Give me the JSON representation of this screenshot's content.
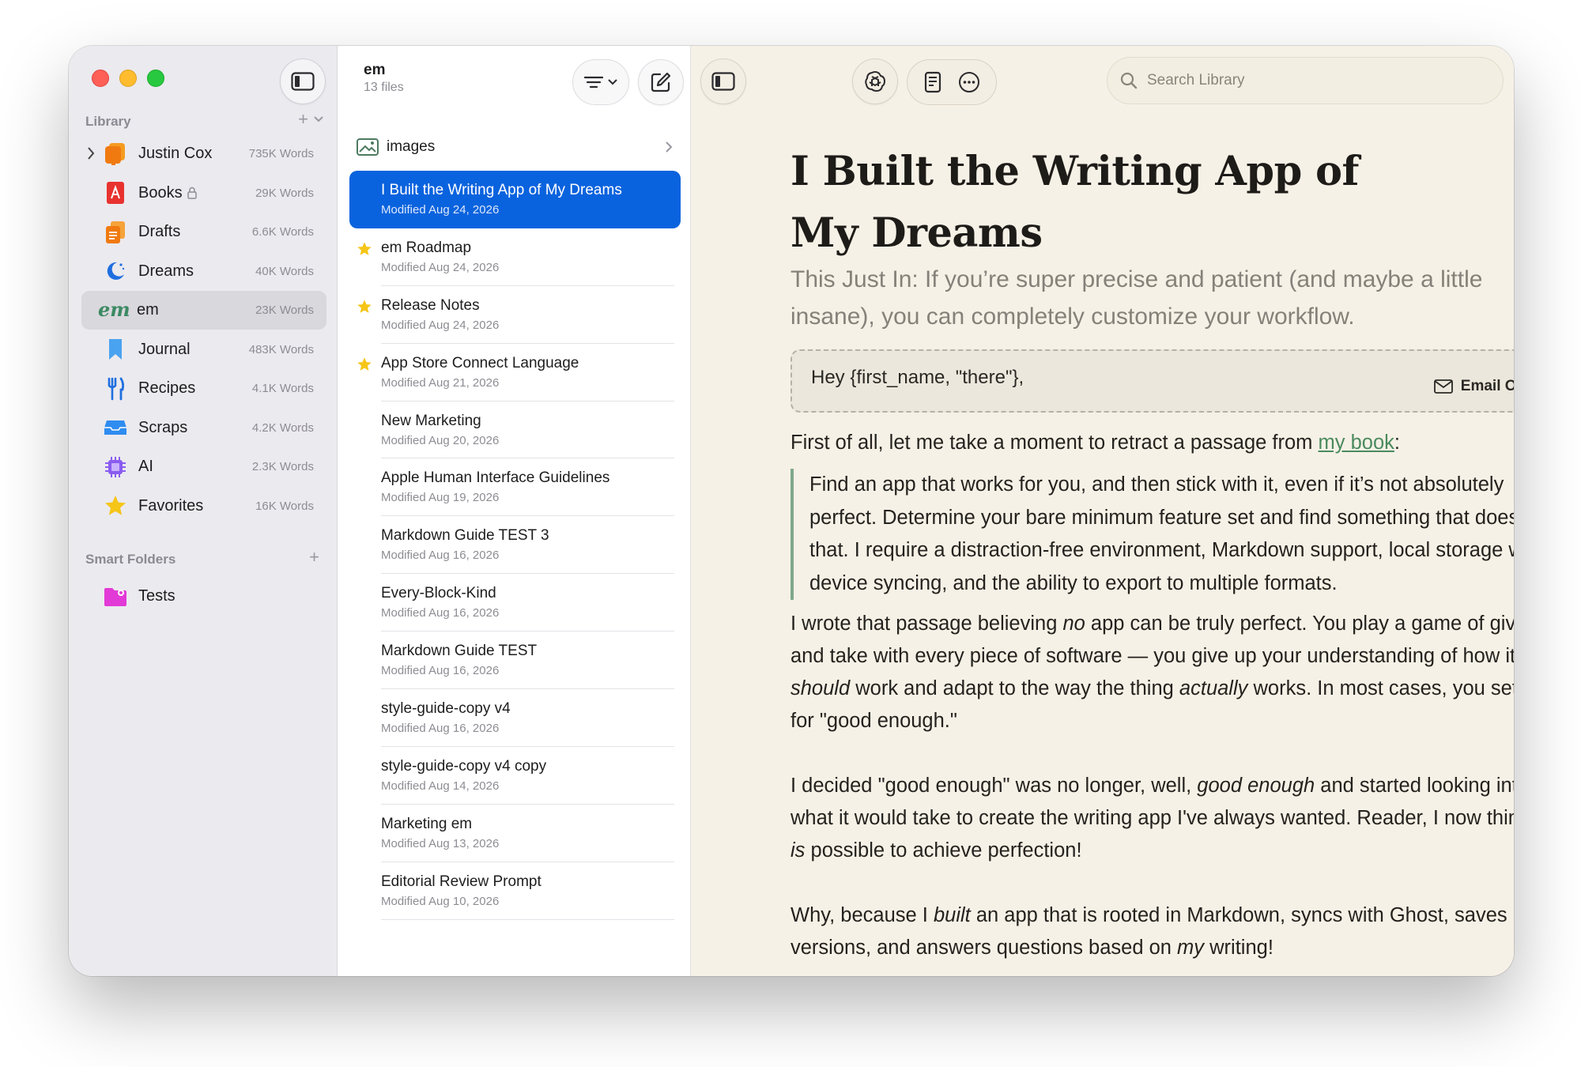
{
  "sidebar": {
    "library_label": "Library",
    "library_items": [
      {
        "name": "Justin Cox",
        "count": "735K Words",
        "icon": "orange-stack-icon",
        "has_chevron": true,
        "locked": false
      },
      {
        "name": "Books",
        "count": "29K Words",
        "icon": "red-book-icon",
        "locked": true
      },
      {
        "name": "Drafts",
        "count": "6.6K Words",
        "icon": "orange-documents-icon",
        "locked": false
      },
      {
        "name": "Dreams",
        "count": "40K Words",
        "icon": "blue-moon-icon",
        "locked": false
      },
      {
        "name": "em",
        "count": "23K Words",
        "icon": "em-logo-icon",
        "locked": false,
        "selected": true
      },
      {
        "name": "Journal",
        "count": "483K Words",
        "icon": "blue-bookmark-icon",
        "locked": false
      },
      {
        "name": "Recipes",
        "count": "4.1K Words",
        "icon": "blue-fork-knife-icon",
        "locked": false
      },
      {
        "name": "Scraps",
        "count": "4.2K Words",
        "icon": "blue-tray-icon",
        "locked": false
      },
      {
        "name": "AI",
        "count": "2.3K Words",
        "icon": "purple-chip-icon",
        "locked": false
      },
      {
        "name": "Favorites",
        "count": "16K Words",
        "icon": "yellow-star-icon",
        "locked": false
      }
    ],
    "smart_folders_label": "Smart Folders",
    "smart_folders": [
      {
        "name": "Tests",
        "icon": "magenta-smart-folder-icon"
      }
    ]
  },
  "file_list": {
    "title": "em",
    "subtitle": "13 files",
    "folder": {
      "name": "images",
      "icon": "photo-folder-icon"
    },
    "files": [
      {
        "title": "I Built the Writing App of My Dreams",
        "date": "Modified Aug 24, 2026",
        "starred": false,
        "selected": true
      },
      {
        "title": "em Roadmap",
        "date": "Modified Aug 24, 2026",
        "starred": true
      },
      {
        "title": "Release Notes",
        "date": "Modified Aug 24, 2026",
        "starred": true
      },
      {
        "title": "App Store Connect Language",
        "date": "Modified Aug 21, 2026",
        "starred": true
      },
      {
        "title": "New Marketing",
        "date": "Modified Aug 20, 2026",
        "starred": false
      },
      {
        "title": "Apple Human Interface Guidelines",
        "date": "Modified Aug 19, 2026",
        "starred": false
      },
      {
        "title": "Markdown Guide TEST 3",
        "date": "Modified Aug 16, 2026",
        "starred": false
      },
      {
        "title": "Every-Block-Kind",
        "date": "Modified Aug 16, 2026",
        "starred": false
      },
      {
        "title": "Markdown Guide TEST",
        "date": "Modified Aug 16, 2026",
        "starred": false
      },
      {
        "title": "style-guide-copy v4",
        "date": "Modified Aug 16, 2026",
        "starred": false
      },
      {
        "title": "style-guide-copy v4 copy",
        "date": "Modified Aug 14, 2026",
        "starred": false
      },
      {
        "title": "Marketing em",
        "date": "Modified Aug 13, 2026",
        "starred": false
      },
      {
        "title": "Editorial Review Prompt",
        "date": "Modified Aug 10, 2026",
        "starred": false
      }
    ]
  },
  "toolbar": {
    "search_placeholder": "Search Library"
  },
  "document": {
    "title_line1": "I Built the Writing App of",
    "title_line2": "My Dreams",
    "subtitle": "This Just In: If you’re super precise and patient (and maybe a little insane), you can completely customize your workflow.",
    "email_greeting": "Hey {first_name, \"there\"},",
    "email_tag": "Email Only",
    "p1_before": "First of all, let me take a moment to retract a passage from ",
    "p1_link": "my book",
    "p1_after": ":",
    "quote": "Find an app that works for you, and then stick with it, even if it’s not absolutely perfect. Determine your bare minimum feature set and find something that does that. I require a distraction-free environment, Markdown support, local storage with device syncing, and the ability to export to multiple formats.",
    "p2_a": "I wrote that passage believing ",
    "p2_em1": "no",
    "p2_b": " app can be truly perfect. You play a game of give and take with every piece of software — you give up your understanding of how it ",
    "p2_em2": "should",
    "p2_c": " work and adapt to the way the thing ",
    "p2_em3": "actually",
    "p2_d": " works. In most cases, you settle for \"good enough.\"",
    "p3_a": "I decided \"good enough\" was no longer, well, ",
    "p3_em1": "good enough",
    "p3_b": " and started looking into what it would take to create the writing app I've always wanted. Reader, I now think it ",
    "p3_em2": "is",
    "p3_c": " possible to achieve perfection!",
    "p4_a": "Why, because I ",
    "p4_em1": "built",
    "p4_b": " an app that is rooted in Markdown, syncs with Ghost, saves versions, and answers questions based on ",
    "p4_em2": "my",
    "p4_c": " writing!"
  },
  "colors": {
    "accent_selected": "#0a63de",
    "editor_background": "#f6f1e6",
    "link": "#4a8a5e",
    "quote_bar": "#7fa98a",
    "star": "#f5c518"
  }
}
